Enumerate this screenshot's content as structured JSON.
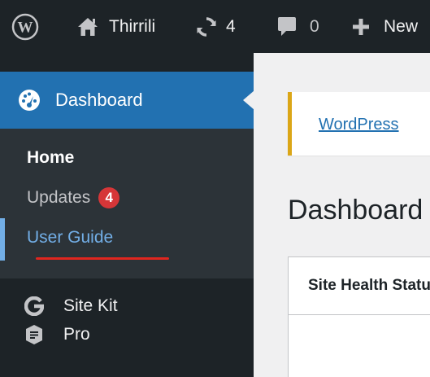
{
  "admin_bar": {
    "site_name": "Thirrili",
    "updates_count": "4",
    "comments_count": "0",
    "new_label": "New"
  },
  "sidebar": {
    "dashboard_label": "Dashboard",
    "submenu": {
      "home": "Home",
      "updates": "Updates",
      "updates_badge": "4",
      "user_guide": "User Guide"
    },
    "items": [
      {
        "label": "Site Kit",
        "icon": "google-g-icon"
      },
      {
        "label": "Pro",
        "icon": "pro-shield-icon"
      }
    ]
  },
  "main": {
    "notice_link": "WordPress",
    "page_title": "Dashboard",
    "widget_title": "Site Health Status"
  },
  "colors": {
    "admin_bar_bg": "#1d2327",
    "active_menu_bg": "#2271b1",
    "submenu_bg": "#2c3338",
    "badge": "#d63638",
    "notice_border": "#dba617",
    "annotation_underline": "#e0261f",
    "link": "#2271b1"
  }
}
